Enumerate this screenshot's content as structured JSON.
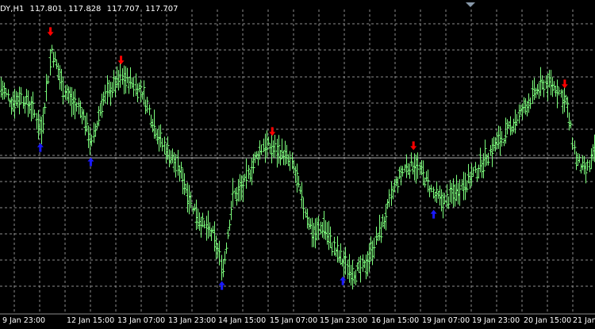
{
  "window": {
    "symbol_timeframe": "DY,H1",
    "ohlc": [
      "117.801",
      "117.828",
      "117.707",
      "117.707"
    ]
  },
  "x_axis_labels": [
    "9 Jan 23:00",
    "12 Jan 15:00",
    "13 Jan 07:00",
    "13 Jan 23:00",
    "14 Jan 15:00",
    "15 Jan 07:00",
    "15 Jan 23:00",
    "16 Jan 15:00",
    "19 Jan 07:00",
    "19 Jan 23:00",
    "20 Jan 15:00",
    "21 Jan"
  ],
  "colors": {
    "background": "#000000",
    "grid": "#8c8c8c",
    "bar": "#7dff7d",
    "sell_arrow": "#ff0000",
    "buy_arrow": "#1a1aff",
    "price_line": "#b0b0b0",
    "text": "#ffffff"
  },
  "icons": {
    "sell_signal": "arrow-down-icon",
    "buy_signal": "arrow-up-icon",
    "scroll_marker": "triangle-down-icon"
  },
  "chart_data": {
    "type": "bar",
    "title": "DY,H1",
    "y_range": [
      116.2,
      119.2
    ],
    "current_price": 117.707,
    "x": [
      "9 Jan 23:00",
      "12 Jan 15:00",
      "13 Jan 07:00",
      "13 Jan 23:00",
      "14 Jan 15:00",
      "15 Jan 07:00",
      "15 Jan 23:00",
      "16 Jan 15:00",
      "19 Jan 07:00",
      "19 Jan 23:00",
      "20 Jan 15:00",
      "21 Jan"
    ],
    "series": [
      {
        "values": [
          118.45,
          118.3,
          118.35,
          118.25,
          118.0,
          118.85,
          118.5,
          118.3,
          118.2,
          117.85,
          118.3,
          118.45,
          118.55,
          118.5,
          118.4,
          118.1,
          117.85,
          117.7,
          117.5,
          117.2,
          117.0,
          116.9,
          116.55,
          117.3,
          117.4,
          117.65,
          117.85,
          117.8,
          117.75,
          117.6,
          117.2,
          116.9,
          117.0,
          116.75,
          116.6,
          116.5,
          116.55,
          116.8,
          117.05,
          117.4,
          117.6,
          117.65,
          117.5,
          117.3,
          117.25,
          117.35,
          117.45,
          117.55,
          117.7,
          117.85,
          117.95,
          118.1,
          118.25,
          118.4,
          118.5,
          118.45,
          118.3,
          117.7,
          117.55,
          117.8
        ]
      }
    ],
    "signals": [
      {
        "type": "sell",
        "index": 5
      },
      {
        "type": "buy",
        "index": 4
      },
      {
        "type": "buy",
        "index": 9
      },
      {
        "type": "sell",
        "index": 12
      },
      {
        "type": "buy",
        "index": 22
      },
      {
        "type": "sell",
        "index": 27
      },
      {
        "type": "buy",
        "index": 34
      },
      {
        "type": "sell",
        "index": 41
      },
      {
        "type": "buy",
        "index": 43
      },
      {
        "type": "sell",
        "index": 56
      }
    ],
    "grid": true
  }
}
